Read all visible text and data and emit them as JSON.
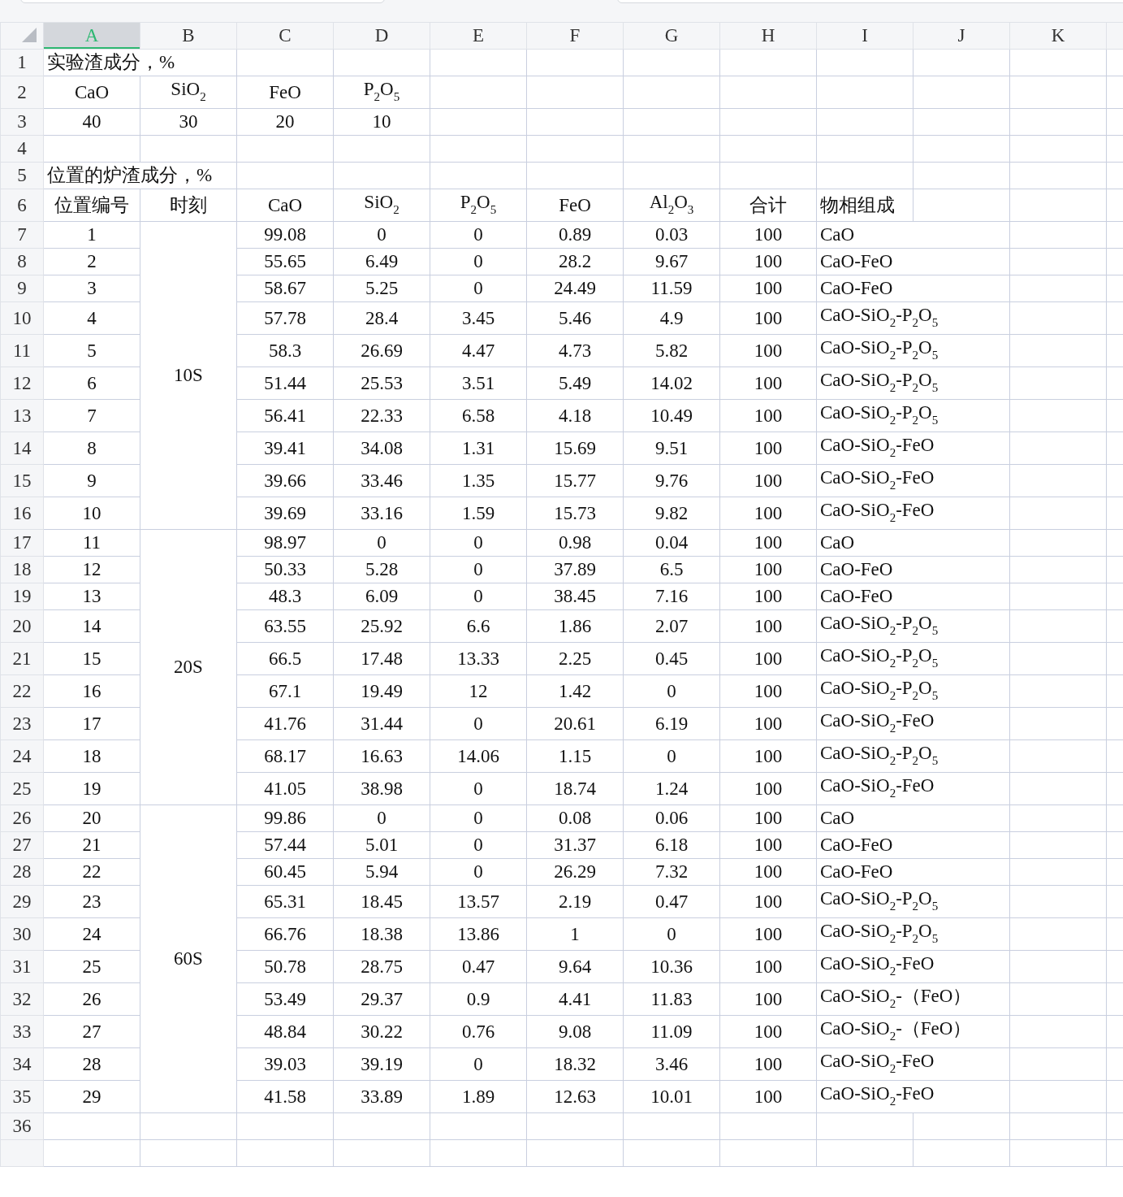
{
  "column_headers": [
    {
      "label": "A",
      "selected": true
    },
    {
      "label": "B",
      "selected": false
    },
    {
      "label": "C",
      "selected": false
    },
    {
      "label": "D",
      "selected": false
    },
    {
      "label": "E",
      "selected": false
    },
    {
      "label": "F",
      "selected": false
    },
    {
      "label": "G",
      "selected": false
    },
    {
      "label": "H",
      "selected": false
    },
    {
      "label": "I",
      "selected": false
    },
    {
      "label": "J",
      "selected": false
    },
    {
      "label": "K",
      "selected": false
    }
  ],
  "row_numbers": [
    "1",
    "2",
    "3",
    "4",
    "5",
    "6",
    "7",
    "8",
    "9",
    "10",
    "11",
    "12",
    "13",
    "14",
    "15",
    "16",
    "17",
    "18",
    "19",
    "20",
    "21",
    "22",
    "23",
    "24",
    "25",
    "26",
    "27",
    "28",
    "29",
    "30",
    "31",
    "32",
    "33",
    "34",
    "35",
    "36"
  ],
  "experiment_title": "实验渣成分，%",
  "experiment_slag": {
    "headers": [
      "CaO",
      "SiO$_{2}$",
      "FeO",
      "P$_{2}$O$_{5}$"
    ],
    "values": [
      "40",
      "30",
      "20",
      "10"
    ]
  },
  "position_title": "位置的炉渣成分，%",
  "table": {
    "columns": [
      "位置编号",
      "时刻",
      "CaO",
      "SiO$_{2}$",
      "P$_{2}$O$_{5}$",
      "FeO",
      "Al$_{2}$O$_{3}$",
      "合计",
      "物相组成"
    ],
    "groups": [
      {
        "time": "10S",
        "rows": [
          [
            "1",
            "99.08",
            "0",
            "0",
            "0.89",
            "0.03",
            "100",
            "CaO"
          ],
          [
            "2",
            "55.65",
            "6.49",
            "0",
            "28.2",
            "9.67",
            "100",
            "CaO-FeO"
          ],
          [
            "3",
            "58.67",
            "5.25",
            "0",
            "24.49",
            "11.59",
            "100",
            "CaO-FeO"
          ],
          [
            "4",
            "57.78",
            "28.4",
            "3.45",
            "5.46",
            "4.9",
            "100",
            "CaO-SiO$_{2}$-P$_{2}$O$_{5}$"
          ],
          [
            "5",
            "58.3",
            "26.69",
            "4.47",
            "4.73",
            "5.82",
            "100",
            "CaO-SiO$_{2}$-P$_{2}$O$_{5}$"
          ],
          [
            "6",
            "51.44",
            "25.53",
            "3.51",
            "5.49",
            "14.02",
            "100",
            "CaO-SiO$_{2}$-P$_{2}$O$_{5}$"
          ],
          [
            "7",
            "56.41",
            "22.33",
            "6.58",
            "4.18",
            "10.49",
            "100",
            "CaO-SiO$_{2}$-P$_{2}$O$_{5}$"
          ],
          [
            "8",
            "39.41",
            "34.08",
            "1.31",
            "15.69",
            "9.51",
            "100",
            "CaO-SiO$_{2}$-FeO"
          ],
          [
            "9",
            "39.66",
            "33.46",
            "1.35",
            "15.77",
            "9.76",
            "100",
            "CaO-SiO$_{2}$-FeO"
          ],
          [
            "10",
            "39.69",
            "33.16",
            "1.59",
            "15.73",
            "9.82",
            "100",
            "CaO-SiO$_{2}$-FeO"
          ]
        ]
      },
      {
        "time": "20S",
        "rows": [
          [
            "11",
            "98.97",
            "0",
            "0",
            "0.98",
            "0.04",
            "100",
            "CaO"
          ],
          [
            "12",
            "50.33",
            "5.28",
            "0",
            "37.89",
            "6.5",
            "100",
            "CaO-FeO"
          ],
          [
            "13",
            "48.3",
            "6.09",
            "0",
            "38.45",
            "7.16",
            "100",
            "CaO-FeO"
          ],
          [
            "14",
            "63.55",
            "25.92",
            "6.6",
            "1.86",
            "2.07",
            "100",
            "CaO-SiO$_{2}$-P$_{2}$O$_{5}$"
          ],
          [
            "15",
            "66.5",
            "17.48",
            "13.33",
            "2.25",
            "0.45",
            "100",
            "CaO-SiO$_{2}$-P$_{2}$O$_{5}$"
          ],
          [
            "16",
            "67.1",
            "19.49",
            "12",
            "1.42",
            "0",
            "100",
            "CaO-SiO$_{2}$-P$_{2}$O$_{5}$"
          ],
          [
            "17",
            "41.76",
            "31.44",
            "0",
            "20.61",
            "6.19",
            "100",
            "CaO-SiO$_{2}$-FeO"
          ],
          [
            "18",
            "68.17",
            "16.63",
            "14.06",
            "1.15",
            "0",
            "100",
            "CaO-SiO$_{2}$-P$_{2}$O$_{5}$"
          ],
          [
            "19",
            "41.05",
            "38.98",
            "0",
            "18.74",
            "1.24",
            "100",
            "CaO-SiO$_{2}$-FeO"
          ]
        ]
      },
      {
        "time": "60S",
        "rows": [
          [
            "20",
            "99.86",
            "0",
            "0",
            "0.08",
            "0.06",
            "100",
            "CaO"
          ],
          [
            "21",
            "57.44",
            "5.01",
            "0",
            "31.37",
            "6.18",
            "100",
            "CaO-FeO"
          ],
          [
            "22",
            "60.45",
            "5.94",
            "0",
            "26.29",
            "7.32",
            "100",
            "CaO-FeO"
          ],
          [
            "23",
            "65.31",
            "18.45",
            "13.57",
            "2.19",
            "0.47",
            "100",
            "CaO-SiO$_{2}$-P$_{2}$O$_{5}$"
          ],
          [
            "24",
            "66.76",
            "18.38",
            "13.86",
            "1",
            "0",
            "100",
            "CaO-SiO$_{2}$-P$_{2}$O$_{5}$"
          ],
          [
            "25",
            "50.78",
            "28.75",
            "0.47",
            "9.64",
            "10.36",
            "100",
            "CaO-SiO$_{2}$-FeO"
          ],
          [
            "26",
            "53.49",
            "29.37",
            "0.9",
            "4.41",
            "11.83",
            "100",
            "CaO-SiO$_{2}$-（FeO）"
          ],
          [
            "27",
            "48.84",
            "30.22",
            "0.76",
            "9.08",
            "11.09",
            "100",
            "CaO-SiO$_{2}$-（FeO）"
          ],
          [
            "28",
            "39.03",
            "39.19",
            "0",
            "18.32",
            "3.46",
            "100",
            "CaO-SiO$_{2}$-FeO"
          ],
          [
            "29",
            "41.58",
            "33.89",
            "1.89",
            "12.63",
            "10.01",
            "100",
            "CaO-SiO$_{2}$-FeO"
          ]
        ]
      }
    ]
  }
}
